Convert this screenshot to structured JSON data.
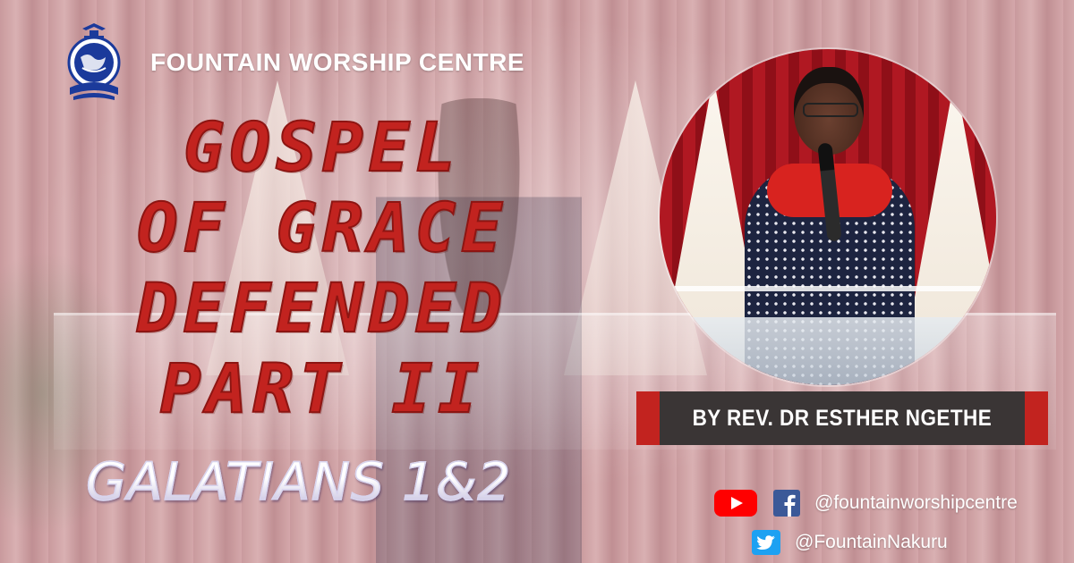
{
  "organization": {
    "name": "FOUNTAIN WORSHIP CENTRE",
    "logo_text": "FOUNTAIN WORSHIP CENTRE"
  },
  "sermon": {
    "title_lines": [
      "GOSPEL",
      "OF GRACE",
      "DEFENDED",
      "PART II"
    ],
    "scripture": "GALATIANS 1&2",
    "speaker": "BY REV. DR ESTHER NGETHE"
  },
  "social": {
    "youtube_facebook_handle": "@fountainworshipcentre",
    "twitter_handle": "@FountainNakuru",
    "icons": [
      "youtube-icon",
      "facebook-icon",
      "twitter-icon"
    ]
  },
  "colors": {
    "title_red": "#c2231f",
    "banner_dark": "#3a3535",
    "banner_accent": "#c2231f",
    "youtube_red": "#ff0000",
    "facebook_blue": "#3b5998",
    "twitter_blue": "#1da1f2",
    "logo_blue": "#1b3a9b"
  }
}
